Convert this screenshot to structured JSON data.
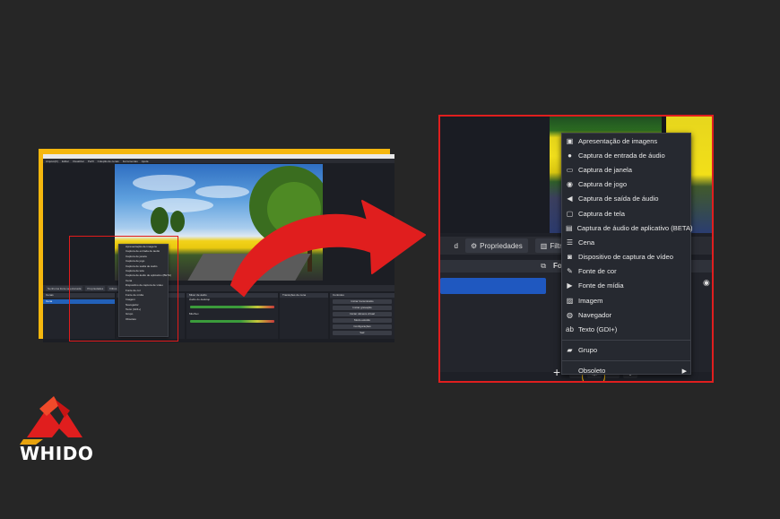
{
  "brand": {
    "name": "WHIDO",
    "accent": "#e01e1e",
    "highlight": "#f2b90d"
  },
  "mini_screenshot": {
    "menu": [
      "Arquivo(F)",
      "Editar",
      "Visualizar",
      "Perfil",
      "Coleção de cenas",
      "Ferramentas",
      "Ajuda"
    ],
    "tabs": [
      "Nenhuma fonte selecionada",
      "Propriedades",
      "Filtros"
    ],
    "docks": {
      "scenes": "Cenas",
      "scene_selected": "Cena",
      "sources": "Fontes",
      "audio_mixer": "Mixer de áudio",
      "audio_tracks": [
        "Áudio do desktop",
        "Mic/Aux"
      ],
      "transitions": "Transições de cena",
      "controls": "Controles",
      "control_buttons": [
        "Iniciar transmissão",
        "Iniciar gravação",
        "Iniciar câmera virtual",
        "Modo estúdio",
        "Configurações",
        "Sair"
      ]
    }
  },
  "zoom": {
    "tab_partial": "d",
    "tabs": [
      {
        "icon": "gear-icon",
        "label": "Propriedades"
      },
      {
        "icon": "filter-icon",
        "label": "Filtros"
      }
    ],
    "sources_header": "Fo",
    "menu_items": [
      {
        "icon": "slideshow-icon",
        "glyph": "▣",
        "label": "Apresentação de imagens"
      },
      {
        "icon": "microphone-icon",
        "glyph": "●",
        "label": "Captura de entrada de áudio"
      },
      {
        "icon": "window-icon",
        "glyph": "▭",
        "label": "Captura de janela"
      },
      {
        "icon": "gamepad-icon",
        "glyph": "◉",
        "label": "Captura de jogo"
      },
      {
        "icon": "speaker-icon",
        "glyph": "◀",
        "label": "Captura de saída de áudio"
      },
      {
        "icon": "monitor-icon",
        "glyph": "▢",
        "label": "Captura de tela"
      },
      {
        "icon": "app-audio-icon",
        "glyph": "▤",
        "label": "Captura de áudio de aplicativo (BETA)"
      },
      {
        "icon": "list-icon",
        "glyph": "☰",
        "label": "Cena"
      },
      {
        "icon": "camera-icon",
        "glyph": "◙",
        "label": "Dispositivo de captura de vídeo"
      },
      {
        "icon": "brush-icon",
        "glyph": "✎",
        "label": "Fonte de cor"
      },
      {
        "icon": "play-icon",
        "glyph": "▶",
        "label": "Fonte de mídia"
      },
      {
        "icon": "image-icon",
        "glyph": "▨",
        "label": "Imagem"
      },
      {
        "icon": "globe-icon",
        "glyph": "◍",
        "label": "Navegador"
      },
      {
        "icon": "text-icon",
        "glyph": "ab",
        "label": "Texto (GDI+)"
      },
      {
        "icon": "folder-icon",
        "glyph": "▰",
        "label": "Grupo"
      },
      {
        "icon": "deprecated-icon",
        "glyph": "",
        "label": "Obsoleto"
      }
    ]
  }
}
